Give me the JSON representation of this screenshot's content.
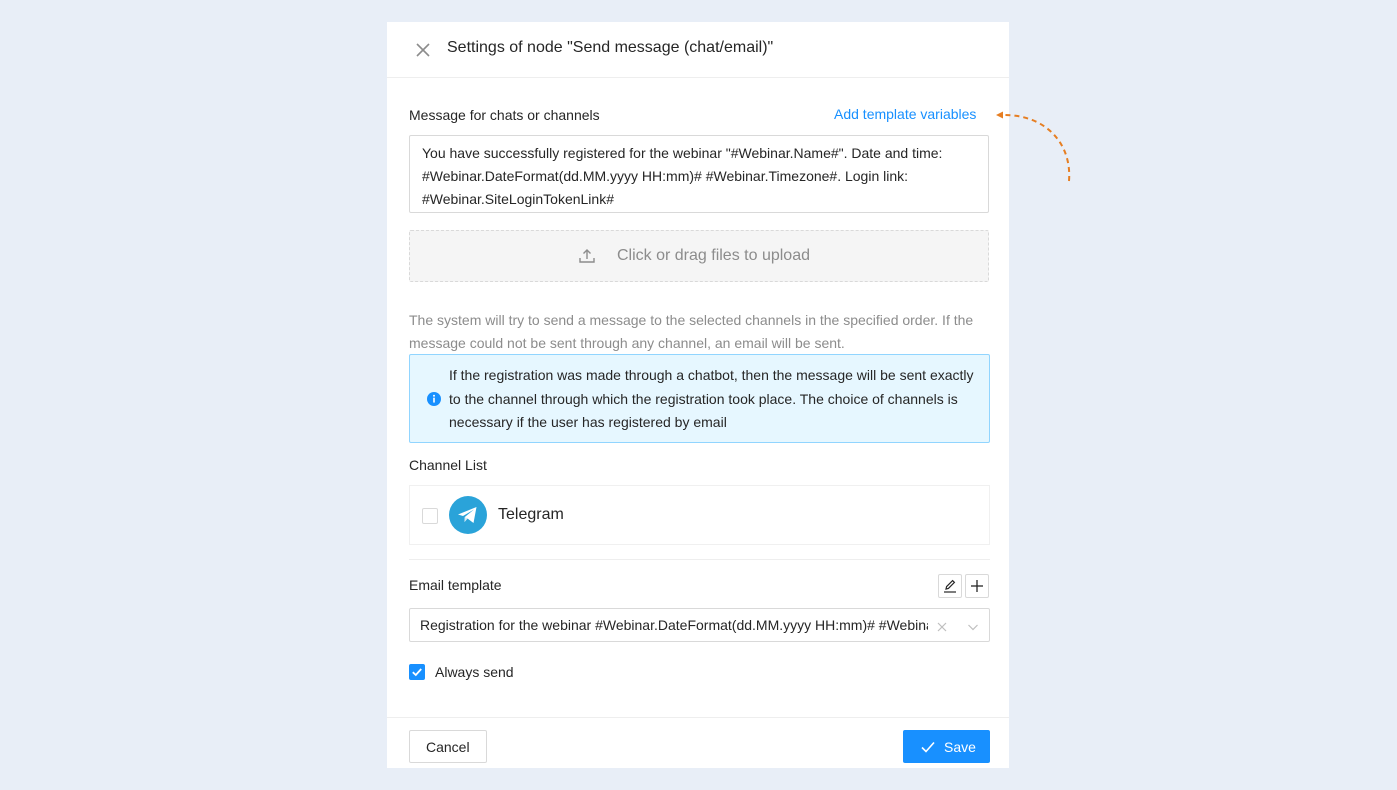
{
  "header": {
    "title": "Settings of node \"Send message (chat/email)\""
  },
  "message": {
    "label": "Message for chats or channels",
    "add_variables_link": "Add template variables",
    "text": "You have successfully registered for the webinar \"#Webinar.Name#\". Date and time: #Webinar.DateFormat(dd.MM.yyyy HH:mm)# #Webinar.Timezone#. Login link: #Webinar.SiteLoginTokenLink#"
  },
  "upload": {
    "text": "Click or drag files to upload",
    "icon": "upload-icon"
  },
  "hint": "The system will try to send a message to the selected channels in the specified order. If the message could not be sent through any channel, an email will be sent.",
  "alert": {
    "icon": "info-icon",
    "text": "If the registration was made through a chatbot, then the message will be sent exactly to the channel through which the registration took place. The choice of channels is necessary if the user has registered by email"
  },
  "channels": {
    "label": "Channel List",
    "items": [
      {
        "name": "Telegram",
        "checked": false,
        "icon": "telegram-icon"
      }
    ]
  },
  "email_template": {
    "label": "Email template",
    "value": "Registration for the webinar #Webinar.DateFormat(dd.MM.yyyy HH:mm)# #Webinar.Timezone#",
    "edit_icon": "edit-icon",
    "add_icon": "plus-icon"
  },
  "always_send": {
    "label": "Always send",
    "checked": true
  },
  "footer": {
    "cancel_label": "Cancel",
    "save_label": "Save"
  },
  "colors": {
    "accent": "#1890ff",
    "annotation_arrow": "#e67e22",
    "alert_background": "#e6f7ff",
    "telegram": "#2aa3d9"
  }
}
